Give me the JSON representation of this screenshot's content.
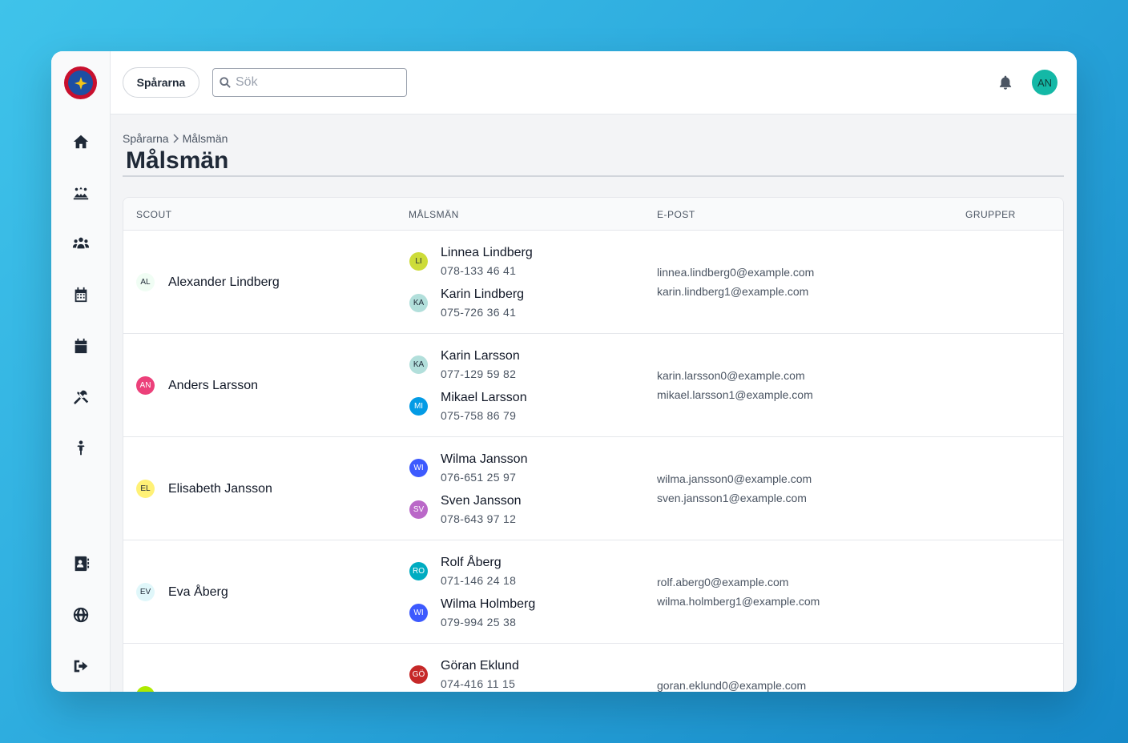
{
  "app": {
    "org_button": "Spårarna",
    "search_placeholder": "Sök",
    "user_initials": "AN",
    "user_avatar_color": "#14b8a6"
  },
  "sidebar": {
    "icons": [
      "home-icon",
      "campfire-icon",
      "users-icon",
      "calendar-grid-icon",
      "calendar-icon",
      "tools-icon",
      "child-icon",
      "address-book-icon",
      "globe-icon",
      "logout-icon"
    ]
  },
  "breadcrumb": {
    "parent": "Spårarna",
    "current": "Målsmän"
  },
  "page": {
    "title": "Målsmän"
  },
  "table": {
    "columns": {
      "scout": "SCOUT",
      "guardians": "MÅLSMÄN",
      "email": "E-POST",
      "groups": "GRUPPER"
    },
    "rows": [
      {
        "scout": {
          "initials": "AL",
          "name": "Alexander Lindberg",
          "color": "#f0fdf4"
        },
        "guardians": [
          {
            "initials": "LI",
            "name": "Linnea Lindberg",
            "phone": "078-133 46 41",
            "color": "#cddc39",
            "email": "linnea.lindberg0@example.com"
          },
          {
            "initials": "KA",
            "name": "Karin Lindberg",
            "phone": "075-726 36 41",
            "color": "#b2dfdb",
            "email": "karin.lindberg1@example.com"
          }
        ]
      },
      {
        "scout": {
          "initials": "AN",
          "name": "Anders Larsson",
          "color": "#ec407a"
        },
        "guardians": [
          {
            "initials": "KA",
            "name": "Karin Larsson",
            "phone": "077-129 59 82",
            "color": "#b2dfdb",
            "email": "karin.larsson0@example.com"
          },
          {
            "initials": "MI",
            "name": "Mikael Larsson",
            "phone": "075-758 86 79",
            "color": "#039be5",
            "email": "mikael.larsson1@example.com"
          }
        ]
      },
      {
        "scout": {
          "initials": "EL",
          "name": "Elisabeth Jansson",
          "color": "#fff176"
        },
        "guardians": [
          {
            "initials": "WI",
            "name": "Wilma Jansson",
            "phone": "076-651 25 97",
            "color": "#3d5afe",
            "email": "wilma.jansson0@example.com"
          },
          {
            "initials": "SV",
            "name": "Sven Jansson",
            "phone": "078-643 97 12",
            "color": "#ba68c8",
            "email": "sven.jansson1@example.com"
          }
        ]
      },
      {
        "scout": {
          "initials": "EV",
          "name": "Eva Åberg",
          "color": "#e0f7fa"
        },
        "guardians": [
          {
            "initials": "RO",
            "name": "Rolf Åberg",
            "phone": "071-146 24 18",
            "color": "#00acc1",
            "email": "rolf.aberg0@example.com"
          },
          {
            "initials": "WI",
            "name": "Wilma Holmberg",
            "phone": "079-994 25 38",
            "color": "#3d5afe",
            "email": "wilma.holmberg1@example.com"
          }
        ]
      },
      {
        "scout": {
          "initials": "",
          "name": "",
          "color": "#aeea00"
        },
        "guardians": [
          {
            "initials": "GÖ",
            "name": "Göran Eklund",
            "phone": "074-416 11 15",
            "color": "#c62828",
            "email": "goran.eklund0@example.com"
          }
        ]
      }
    ]
  }
}
